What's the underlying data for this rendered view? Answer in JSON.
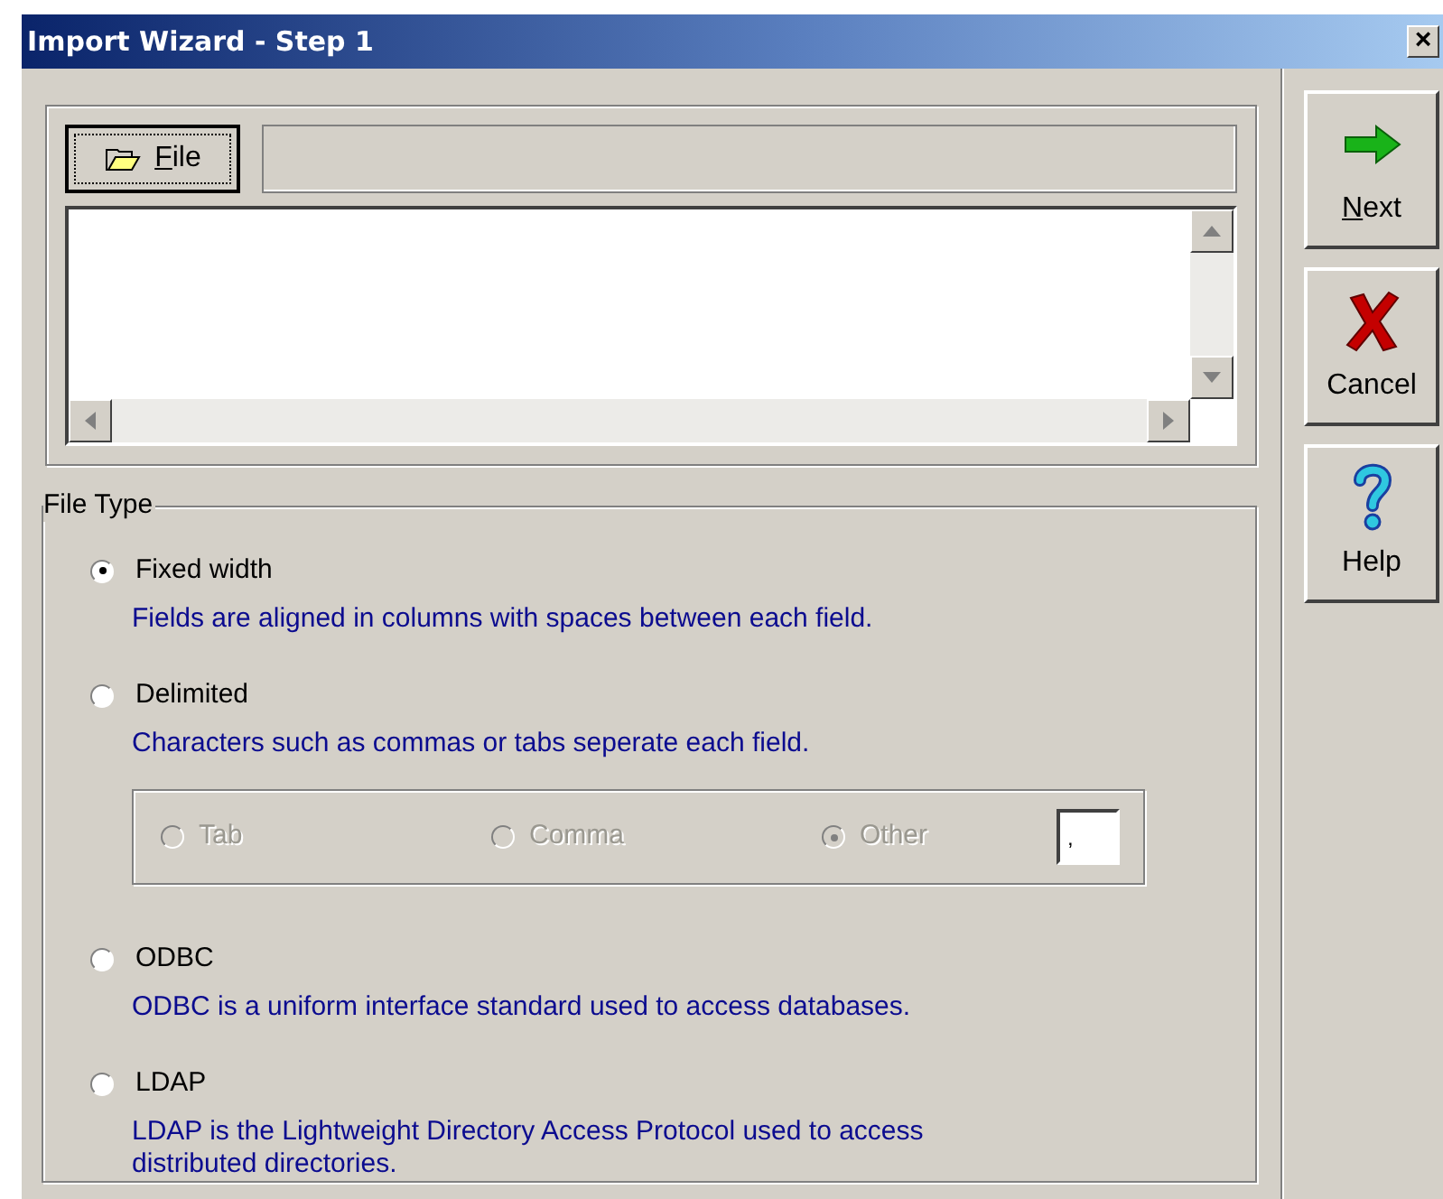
{
  "window": {
    "title": "Import Wizard - Step 1",
    "close": "×"
  },
  "file_button": {
    "label": "File",
    "mnemonic_underline": true
  },
  "side_buttons": [
    {
      "kind": "next",
      "label": "Next",
      "mnemonic_underline": true
    },
    {
      "kind": "cancel",
      "label": "Cancel"
    },
    {
      "kind": "help",
      "label": "Help"
    }
  ],
  "file_type": {
    "legend": "File Type",
    "options": [
      {
        "label": "Fixed width",
        "description": "Fields are aligned in columns with spaces between each field.",
        "selected": true
      },
      {
        "label": "Delimited",
        "description": "Characters such as commas or tabs seperate each field.",
        "selected": false,
        "delimiters": {
          "disabled": true,
          "options": [
            {
              "label": "Tab",
              "selected": false
            },
            {
              "label": "Comma",
              "selected": false
            },
            {
              "label": "Other",
              "selected": true
            }
          ],
          "other_value": ","
        }
      },
      {
        "label": "ODBC",
        "description": "ODBC is a uniform interface standard used to access databases.",
        "selected": false
      },
      {
        "label": "LDAP",
        "description": "LDAP is the Lightweight Directory Access Protocol used to access distributed directories.",
        "selected": false
      }
    ]
  }
}
